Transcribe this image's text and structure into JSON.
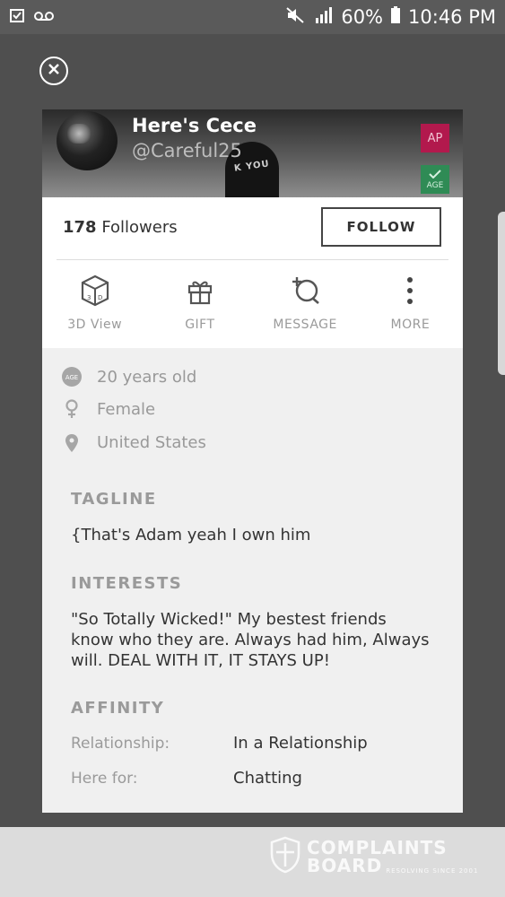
{
  "status_bar": {
    "battery": "60%",
    "time": "10:46 PM"
  },
  "profile": {
    "display_name": "Here's Cece",
    "handle": "@Careful25",
    "badge_ap": "AP",
    "badge_age": "AGE",
    "followers_count": "178",
    "followers_label": "Followers",
    "follow_button": "FOLLOW"
  },
  "actions": [
    {
      "label": "3D View",
      "icon": "3d-cube-icon"
    },
    {
      "label": "GIFT",
      "icon": "gift-icon"
    },
    {
      "label": "MESSAGE",
      "icon": "message-add-icon"
    },
    {
      "label": "MORE",
      "icon": "more-vertical-icon"
    }
  ],
  "details": {
    "age_icon_text": "AGE",
    "age": "20 years old",
    "gender": "Female",
    "location": "United States"
  },
  "tagline": {
    "title": "TAGLINE",
    "text": "{That's Adam yeah I own him"
  },
  "interests": {
    "title": "INTERESTS",
    "text": "\"So Totally Wicked!\" My bestest friends know who they are. Always had him, Always will. DEAL WITH IT, IT STAYS UP!"
  },
  "affinity": {
    "title": "AFFINITY",
    "relationship_label": "Relationship:",
    "relationship_value": "In a Relationship",
    "here_for_label": "Here for:",
    "here_for_value": "Chatting"
  },
  "watermark": {
    "line1": "COMPLAINTS",
    "line2": "BOARD",
    "tag": "RESOLVING SINCE 2001"
  },
  "colors": {
    "badge_ap": "#b2194d",
    "badge_age": "#2f8b55"
  }
}
